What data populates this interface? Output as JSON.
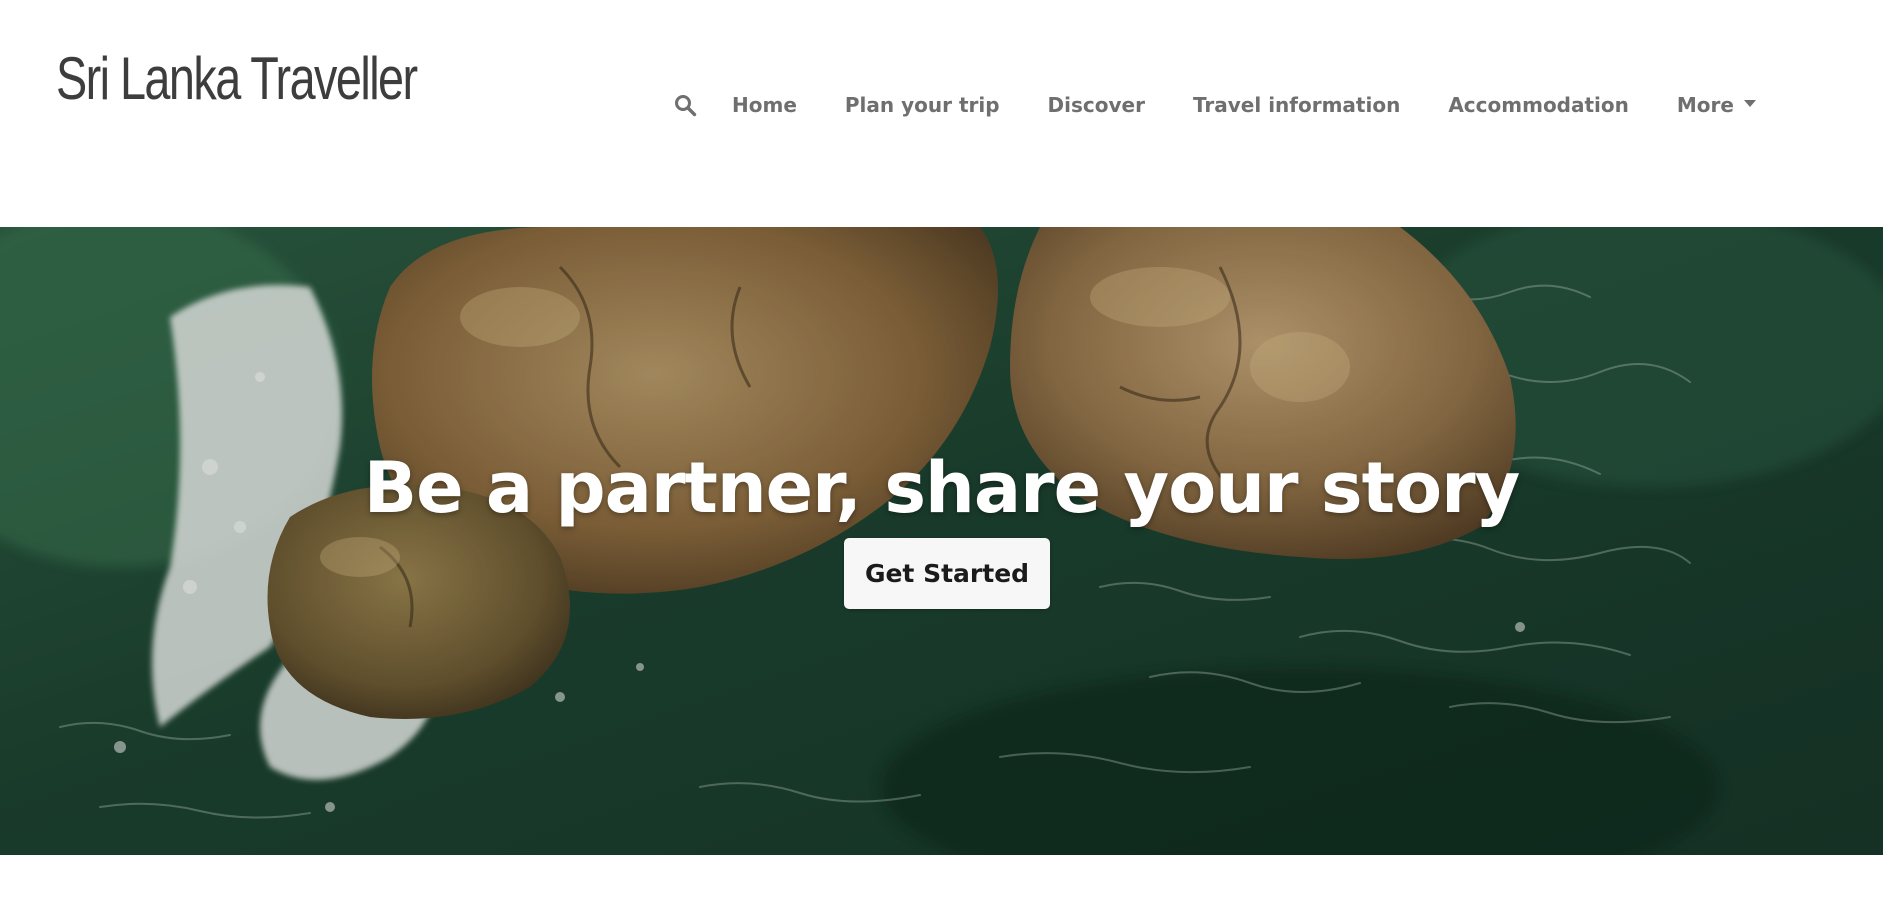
{
  "header": {
    "brand": "Sri Lanka Traveller",
    "nav": {
      "search_icon": "search-icon",
      "items": [
        {
          "label": "Home"
        },
        {
          "label": "Plan your trip"
        },
        {
          "label": "Discover"
        },
        {
          "label": "Travel information"
        },
        {
          "label": "Accommodation"
        },
        {
          "label": "More",
          "has_dropdown": true
        }
      ]
    }
  },
  "hero": {
    "title": "Be a partner, share your story",
    "cta_label": "Get Started",
    "background": "aerial photo of rocks in green sea water with white surf"
  },
  "colors": {
    "nav_text": "#6f6f6f",
    "brand_text": "#3d3d3d",
    "hero_title": "#ffffff",
    "cta_bg": "#f7f7f8",
    "cta_text": "#1b1b1b",
    "sea": "#1f4a35",
    "rock": "#9a7848"
  }
}
